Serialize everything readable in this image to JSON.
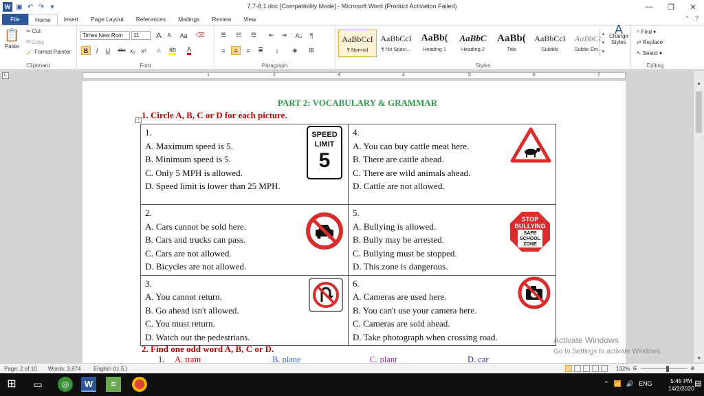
{
  "window": {
    "title": "7.7-8.1.doc [Compatibility Mode]  -  Microsoft Word (Product Activation Failed)",
    "word_logo": "W"
  },
  "tabs": [
    "File",
    "Home",
    "Insert",
    "Page Layout",
    "References",
    "Mailings",
    "Review",
    "View"
  ],
  "ribbon": {
    "clipboard": {
      "paste": "Paste",
      "cut": "Cut",
      "copy": "Copy",
      "format_painter": "Format Painter",
      "label": "Clipboard"
    },
    "font": {
      "name": "Times New Rom",
      "size": "11",
      "label": "Font",
      "grow": "A",
      "shrink": "A",
      "case": "Aa",
      "bold": "B",
      "italic": "I",
      "underline": "U",
      "strike": "abc",
      "sub": "x₂",
      "sup": "x²"
    },
    "paragraph": {
      "label": "Paragraph",
      "show": "¶",
      "sort": "A↓"
    },
    "styles": {
      "label": "Styles",
      "items": [
        {
          "preview": "AaBbCcI",
          "name": "¶ Normal"
        },
        {
          "preview": "AaBbCcI",
          "name": "¶ No Spaci..."
        },
        {
          "preview": "AaBb(",
          "name": "Heading 1"
        },
        {
          "preview": "AaBbC",
          "name": "Heading 2"
        },
        {
          "preview": "AaBb(",
          "name": "Title"
        },
        {
          "preview": "AaBbCcI",
          "name": "Subtitle"
        },
        {
          "preview": "AaBbCc",
          "name": "Subtle Em..."
        }
      ],
      "change_styles": "Change Styles"
    },
    "editing": {
      "find": "Find",
      "replace": "Replace",
      "select": "Select",
      "label": "Editing"
    }
  },
  "ruler": {
    "numbers": [
      "1",
      "2",
      "3",
      "4",
      "5",
      "6",
      "7"
    ]
  },
  "document": {
    "part_title": "PART 2: VOCABULARY & GRAMMAR",
    "q1_head": "1.    Circle A, B, C or D for each picture.",
    "cells": [
      {
        "num": "1.",
        "opts": [
          "A. Maximum speed is 5.",
          "B. Minimum speed is 5.",
          "C. Only 5 MPH is allowed.",
          "D.   Speed   limit   is   lower   than   25 MPH."
        ]
      },
      {
        "num": "4.",
        "opts": [
          "A. You can buy cattle meat here.",
          "B. There are cattle ahead.",
          "C. There are wild animals ahead.",
          "D. Cattle are not allowed."
        ]
      },
      {
        "num": "2.",
        "opts": [
          "A. Cars cannot be sold here.",
          "B. Cars and trucks can pass.",
          "C. Cars are not allowed.",
          "D. Bicycles are not allowed."
        ]
      },
      {
        "num": "5.",
        "opts": [
          "A. Bullying is allowed.",
          "B. Bully may be arrested.",
          "C. Bullying must be stopped.",
          "D. This zone is dangerous."
        ]
      },
      {
        "num": "3.",
        "opts": [
          "A. You cannot return.",
          "B. Go ahead isn't allowed.",
          "C. You must return.",
          "D. Watch out the pedestrians."
        ]
      },
      {
        "num": "6.",
        "opts": [
          "A. Cameras are used here.",
          "B. You can't use your camera here.",
          "C. Cameras are sold ahead.",
          "D. Take photograph when crossing road."
        ]
      }
    ],
    "signs": {
      "speed_top": "SPEED",
      "speed_mid": "LIMIT",
      "speed_num": "5",
      "bully_1": "STOP",
      "bully_2": "BULLYING",
      "bully_3": "SAFE",
      "bully_4": "SCHOOL",
      "bully_5": "ZONE"
    },
    "q2_head": "2.    Find one odd word A, B, C or D.",
    "q2_row": [
      "1.",
      "A. train",
      "B. plane",
      "C. plant",
      "D. car"
    ]
  },
  "watermark": {
    "line1": "Activate Windows",
    "line2": "Go to Settings to activate Windows."
  },
  "status": {
    "page": "Page: 2 of 10",
    "words": "Words: 3,874",
    "lang": "English (U.S.)",
    "zoom": "132%"
  },
  "taskbar": {
    "lang": "ENG",
    "time": "5:45 PM",
    "date": "14/2/2020"
  },
  "colors": {
    "word_blue": "#2b579a",
    "heading_green": "#2e9a4a",
    "question_red": "#c00000",
    "sign_red": "#d92c2c"
  }
}
